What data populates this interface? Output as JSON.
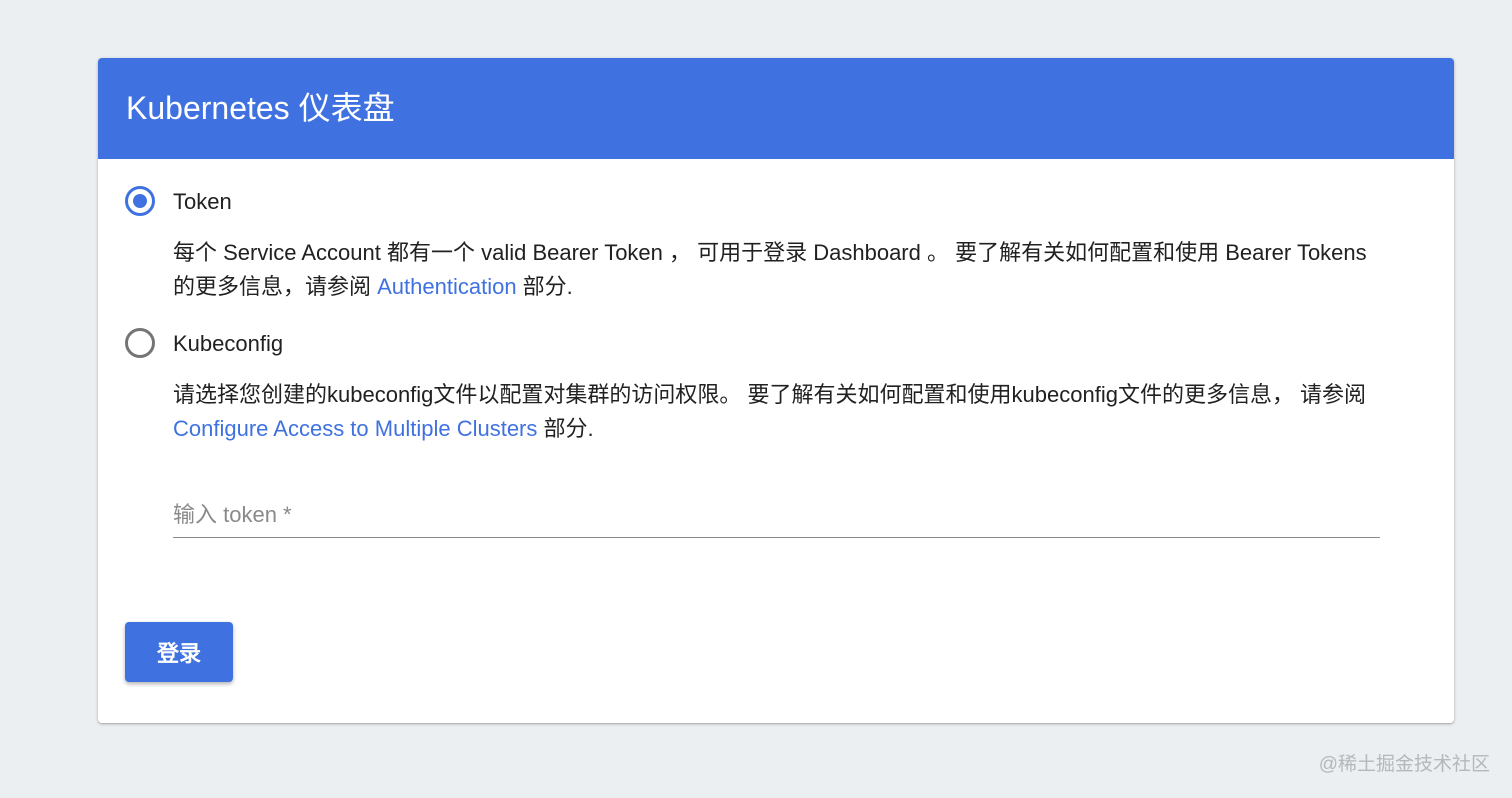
{
  "header": {
    "title": "Kubernetes 仪表盘"
  },
  "auth_options": {
    "selected": "Token",
    "token": {
      "label": "Token",
      "desc_text": "每个 Service Account 都有一个 valid Bearer Token ， 可用于登录 Dashboard 。 要了解有关如何配置和使用 Bearer Tokens 的更多信息，请参阅 ",
      "desc_link": "Authentication",
      "desc_suffix": " 部分."
    },
    "kubeconfig": {
      "label": "Kubeconfig",
      "desc_text": "请选择您创建的kubeconfig文件以配置对集群的访问权限。 要了解有关如何配置和使用kubeconfig文件的更多信息， 请参阅",
      "desc_link": "Configure Access to Multiple Clusters",
      "desc_suffix": " 部分."
    }
  },
  "token_input": {
    "placeholder": "输入 token *",
    "value": ""
  },
  "login_button": {
    "label": "登录"
  },
  "watermark": {
    "text": "@稀土掘金技术社区"
  },
  "colors": {
    "primary": "#3f72e0",
    "background": "#eceff1",
    "card": "#ffffff",
    "text": "#212121",
    "muted": "#8a8a8a",
    "radio_unchecked": "#757575"
  }
}
